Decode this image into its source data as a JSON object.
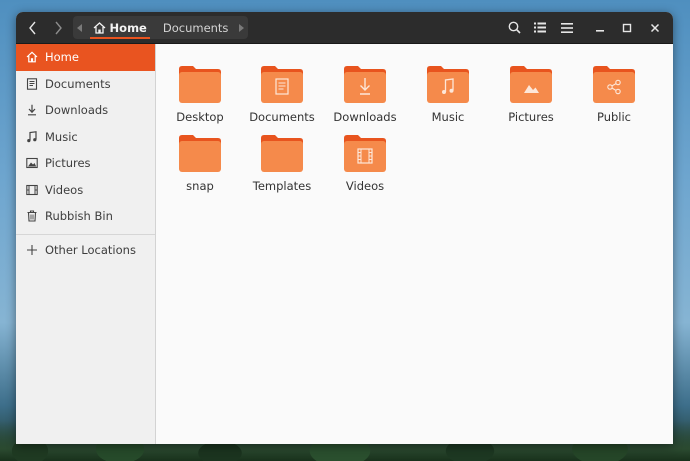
{
  "breadcrumb": {
    "home_label": "Home",
    "documents_label": "Documents"
  },
  "sidebar": {
    "items": [
      {
        "label": "Home",
        "icon": "home-icon",
        "active": true
      },
      {
        "label": "Documents",
        "icon": "document-icon",
        "active": false
      },
      {
        "label": "Downloads",
        "icon": "download-icon",
        "active": false
      },
      {
        "label": "Music",
        "icon": "music-icon",
        "active": false
      },
      {
        "label": "Pictures",
        "icon": "picture-icon",
        "active": false
      },
      {
        "label": "Videos",
        "icon": "video-icon",
        "active": false
      },
      {
        "label": "Rubbish Bin",
        "icon": "trash-icon",
        "active": false
      }
    ],
    "other_locations": "Other Locations"
  },
  "folders": [
    {
      "label": "Desktop",
      "emblem": "none"
    },
    {
      "label": "Documents",
      "emblem": "document-icon"
    },
    {
      "label": "Downloads",
      "emblem": "download-icon"
    },
    {
      "label": "Music",
      "emblem": "music-icon"
    },
    {
      "label": "Pictures",
      "emblem": "picture-icon"
    },
    {
      "label": "Public",
      "emblem": "share-icon"
    },
    {
      "label": "snap",
      "emblem": "none"
    },
    {
      "label": "Templates",
      "emblem": "template-icon"
    },
    {
      "label": "Videos",
      "emblem": "video-icon"
    }
  ],
  "colors": {
    "accent": "#e95420",
    "folder_top": "#e8541e",
    "folder_body": "#f58a4b",
    "headerbar": "#2c2c2c",
    "sidebar_bg": "#f0f0f0"
  }
}
